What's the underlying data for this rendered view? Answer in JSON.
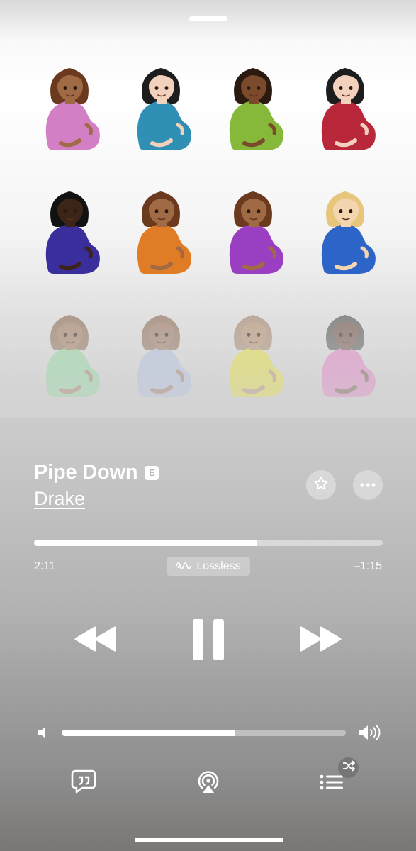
{
  "now_playing": {
    "title": "Pipe Down",
    "explicit_badge": "E",
    "artist": "Drake",
    "elapsed": "2:11",
    "remaining": "–1:15",
    "progress_fraction": 0.64,
    "quality_label": "Lossless",
    "volume_fraction": 0.61
  },
  "artwork": {
    "description_icon": "pregnant-woman-emoji",
    "figures": [
      {
        "shirt": "#d27fc6",
        "skin": "#a06a45",
        "hair": "#6b3a1e"
      },
      {
        "shirt": "#2f8fb5",
        "skin": "#f2d2bc",
        "hair": "#1d1d1d"
      },
      {
        "shirt": "#86b83a",
        "skin": "#7a4a2a",
        "hair": "#2a1a12"
      },
      {
        "shirt": "#b8283a",
        "skin": "#f2d2bc",
        "hair": "#1d1d1d"
      },
      {
        "shirt": "#3a2d9c",
        "skin": "#3c2418",
        "hair": "#111111"
      },
      {
        "shirt": "#e07c25",
        "skin": "#a06a45",
        "hair": "#6b3a1e"
      },
      {
        "shirt": "#9b3fc2",
        "skin": "#a06a45",
        "hair": "#6b3a1e"
      },
      {
        "shirt": "#2d64c8",
        "skin": "#f3d6b0",
        "hair": "#e7c57a"
      },
      {
        "shirt": "#8fd79f",
        "skin": "#a07a60",
        "hair": "#8e6e58"
      },
      {
        "shirt": "#aebedf",
        "skin": "#9a7560",
        "hair": "#8e6e58"
      },
      {
        "shirt": "#e4e03a",
        "skin": "#b68e6e",
        "hair": "#a68770"
      },
      {
        "shirt": "#e07fc4",
        "skin": "#6e5044",
        "hair": "#555555"
      }
    ]
  },
  "icons": {
    "favorite": "star-icon",
    "more": "ellipsis-icon",
    "rewind": "rewind-icon",
    "pause": "pause-icon",
    "fast_forward": "fast-forward-icon",
    "volume_low": "speaker-low-icon",
    "volume_high": "speaker-high-icon",
    "lyrics": "lyrics-quote-icon",
    "airplay": "airplay-icon",
    "queue": "queue-list-icon",
    "shuffle": "shuffle-icon"
  }
}
